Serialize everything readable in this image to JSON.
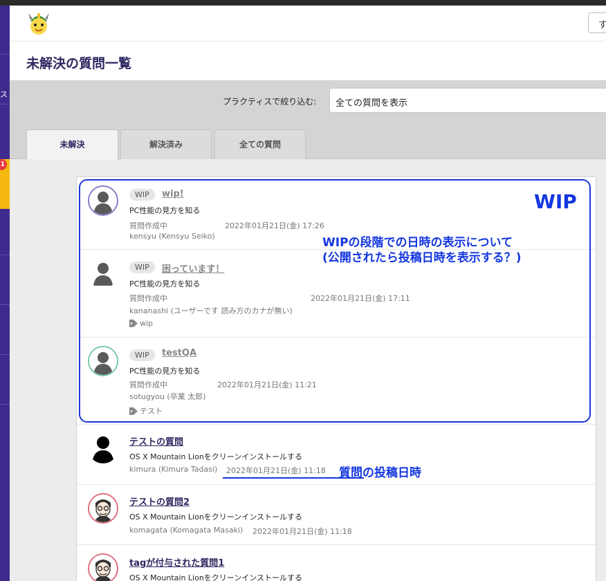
{
  "header": {
    "button_label": "す"
  },
  "sidebar": {
    "badge": "1",
    "letter": "ス"
  },
  "page_title": "未解決の質問一覧",
  "filter": {
    "label": "プラクティスで絞り込む:",
    "selected": "全ての質問を表示"
  },
  "tabs": [
    {
      "label": "未解決"
    },
    {
      "label": "解決済み"
    },
    {
      "label": "全ての質問"
    }
  ],
  "questions": [
    {
      "badge": "WIP",
      "title": "wip!",
      "practice": "PC性能の見方を知る",
      "status": "質問作成中",
      "date": "2022年01月21日(金) 17:26",
      "user": "kensyu (Kensyu Seiko)",
      "tag": ""
    },
    {
      "badge": "WIP",
      "title": "困っています！",
      "practice": "PC性能の見方を知る",
      "status": "質問作成中",
      "date": "2022年01月21日(金) 17:11",
      "user": "kananashi (ユーザーです 読み方のカナが無い)",
      "tag": "wip"
    },
    {
      "badge": "WIP",
      "title": "testQA",
      "practice": "PC性能の見方を知る",
      "status": "質問作成中",
      "date": "2022年01月21日(金) 11:21",
      "user": "sotugyou (卒業 太郎)",
      "tag": "テスト"
    },
    {
      "title": "テストの質問",
      "practice": "OS X Mountain Lionをクリーンインストールする",
      "user": "kimura (Kimura Tadasi)",
      "date": "2022年01月21日(金) 11:18"
    },
    {
      "title": "テストの質問2",
      "practice": "OS X Mountain Lionをクリーンインストールする",
      "user": "komagata (Komagata Masaki)",
      "date": "2022年01月21日(金) 11:18"
    },
    {
      "title": "tagが付与された質問1",
      "practice": "OS X Mountain Lionをクリーンインストールする"
    }
  ],
  "annotations": {
    "wip": "WIP",
    "note_line1": "WIPの段階での日時の表示について",
    "note_line2": "(公開されたら投稿日時を表示する？)",
    "post_date": "質問の投稿日時"
  },
  "colors": {
    "brand": "#3f2a8f",
    "title": "#2d2760",
    "annotation": "#1437e0",
    "sidebar_active": "#f6b90f",
    "badge": "#e9383f"
  }
}
